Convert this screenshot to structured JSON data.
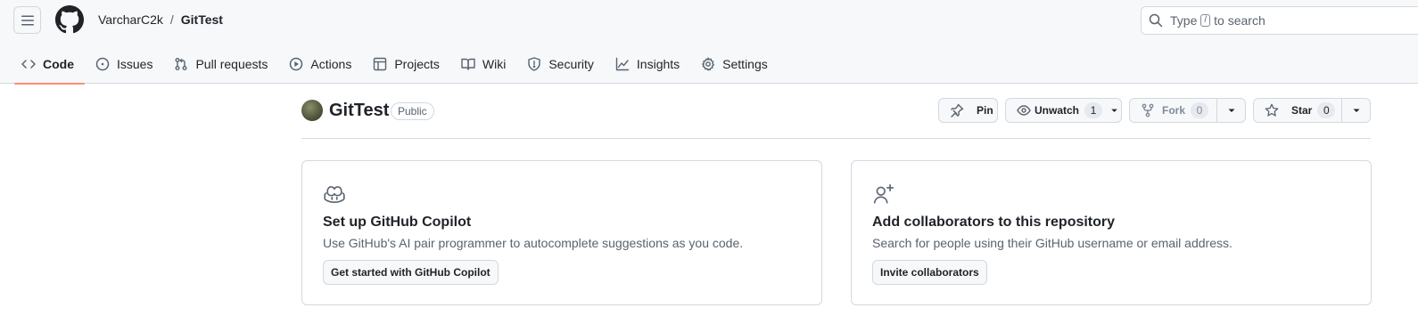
{
  "breadcrumb": {
    "owner": "VarcharC2k",
    "separator": "/",
    "repo": "GitTest"
  },
  "search": {
    "prefix": "Type",
    "key": "/",
    "suffix": "to search"
  },
  "tabs": [
    {
      "label": "Code",
      "icon": "code-icon",
      "selected": true
    },
    {
      "label": "Issues",
      "icon": "issue-opened-icon"
    },
    {
      "label": "Pull requests",
      "icon": "git-pull-request-icon"
    },
    {
      "label": "Actions",
      "icon": "play-icon"
    },
    {
      "label": "Projects",
      "icon": "table-icon"
    },
    {
      "label": "Wiki",
      "icon": "book-icon"
    },
    {
      "label": "Security",
      "icon": "shield-icon"
    },
    {
      "label": "Insights",
      "icon": "graph-icon"
    },
    {
      "label": "Settings",
      "icon": "gear-icon"
    }
  ],
  "repo": {
    "name": "GitTest",
    "visibility": "Public"
  },
  "actions": {
    "pin": "Pin",
    "unwatch": "Unwatch",
    "watch_count": "1",
    "fork": "Fork",
    "fork_count": "0",
    "star": "Star",
    "star_count": "0"
  },
  "cards": [
    {
      "icon": "copilot-icon",
      "title": "Set up GitHub Copilot",
      "description": "Use GitHub's AI pair programmer to autocomplete suggestions as you code.",
      "button": "Get started with GitHub Copilot"
    },
    {
      "icon": "person-add-icon",
      "title": "Add collaborators to this repository",
      "description": "Search for people using their GitHub username or email address.",
      "button": "Invite collaborators"
    }
  ],
  "colors": {
    "accent_underline": "#fd8c73",
    "header_bg": "#f6f8fa",
    "border": "#d1d9e0",
    "muted_text": "#59636e"
  }
}
